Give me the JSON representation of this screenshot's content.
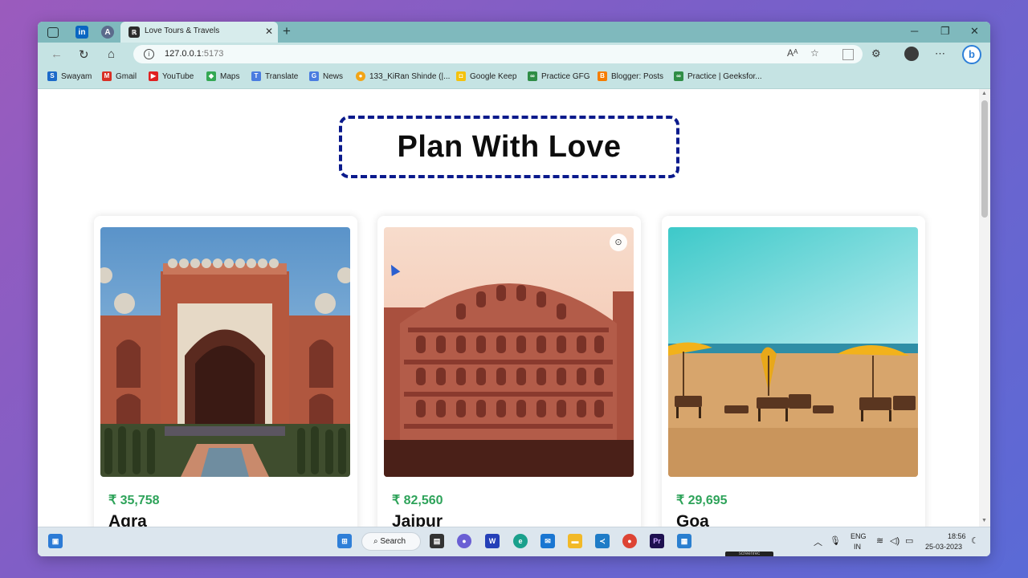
{
  "browser": {
    "tab_title": "Love Tours & Travels",
    "tab_favicon": "ℝ",
    "url_host": "127.0.0.1",
    "url_port": ":5173",
    "new_tab_label": "+"
  },
  "bookmarks": [
    {
      "label": "Swayam",
      "icon": "S",
      "color": "#1c6ac9"
    },
    {
      "label": "Gmail",
      "icon": "M",
      "color": "#d93025"
    },
    {
      "label": "YouTube",
      "icon": "▶",
      "color": "#e02020"
    },
    {
      "label": "Maps",
      "icon": "◆",
      "color": "#34a853"
    },
    {
      "label": "Translate",
      "icon": "T",
      "color": "#4a7de0"
    },
    {
      "label": "News",
      "icon": "G",
      "color": "#4a7de0"
    },
    {
      "label": "133_KiRan Shinde (|...",
      "icon": "●",
      "color": "#f2a516"
    },
    {
      "label": "Google Keep",
      "icon": "◘",
      "color": "#f4c20d"
    },
    {
      "label": "Practice GFG",
      "icon": "∞",
      "color": "#2f8d46"
    },
    {
      "label": "Blogger: Posts",
      "icon": "B",
      "color": "#f57d00"
    },
    {
      "label": "Practice | Geeksfor...",
      "icon": "∞",
      "color": "#2f8d46"
    }
  ],
  "page": {
    "title": "Plan With Love"
  },
  "cards": [
    {
      "price": "₹ 35,758",
      "city": "Agra",
      "image": "taj-mahal-gate"
    },
    {
      "price": "₹ 82,560",
      "city": "Jaipur",
      "image": "hawa-mahal"
    },
    {
      "price": "₹ 29,695",
      "city": "Goa",
      "image": "beach-umbrellas"
    }
  ],
  "taskbar": {
    "search_label": "Search",
    "lang_top": "ENG",
    "lang_bottom": "IN",
    "time": "18:56",
    "date": "25-03-2023",
    "rec_label": "screenrec"
  },
  "colors": {
    "accent_border": "#0a1a8c",
    "price_green": "#2ea35a",
    "tab_bar": "#7fb9bd",
    "toolbar": "#c5e3e3"
  }
}
